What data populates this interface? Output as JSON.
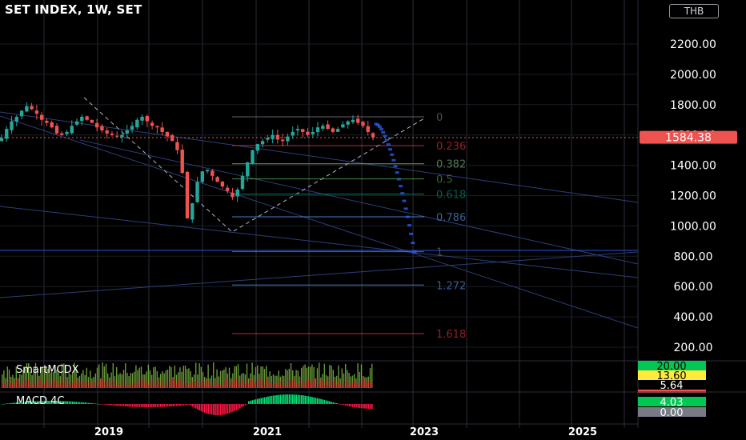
{
  "title": "SET INDEX, 1W, SET",
  "currency_button": "THB",
  "colors": {
    "background": "#000000",
    "up": "#26a69a",
    "down": "#ef5350",
    "fib_level": "#2962ff",
    "trend_line": "#2c3e7a",
    "last_price_badge": "#ef5350"
  },
  "chart_data": [
    {
      "type": "line",
      "title": "SET INDEX, 1W, SET",
      "series": [
        {
          "values": [
            1580,
            1640,
            1690,
            1720,
            1760,
            1790,
            1770,
            1740,
            1700,
            1680,
            1650,
            1610,
            1600,
            1620,
            1660,
            1690,
            1720,
            1700,
            1680,
            1650,
            1630,
            1610,
            1600,
            1590,
            1600,
            1630,
            1660,
            1700,
            1720,
            1690,
            1660,
            1650,
            1620,
            1590,
            1560,
            1500,
            1350,
            1050,
            1150,
            1290,
            1360,
            1370,
            1330,
            1290,
            1260,
            1230,
            1190,
            1240,
            1330,
            1420,
            1500,
            1540,
            1560,
            1580,
            1600,
            1570,
            1560,
            1590,
            1620,
            1640,
            1620,
            1600,
            1620,
            1650,
            1660,
            1640,
            1620,
            1640,
            1670,
            1690,
            1700,
            1680,
            1660,
            1620,
            1584
          ]
        }
      ],
      "x": [
        "2018-02",
        "2018-03",
        "2018-04",
        "2018-05",
        "2018-06",
        "2018-07",
        "2018-08",
        "2018-09",
        "2018-10",
        "2018-11",
        "2018-12",
        "2019-01",
        "2019-02",
        "2019-03",
        "2019-04",
        "2019-05",
        "2019-06",
        "2019-07",
        "2019-08",
        "2019-09",
        "2019-10",
        "2019-11",
        "2019-12",
        "2020-01",
        "2020-02",
        "2020-03a",
        "2020-03b",
        "2020-04",
        "2020-05",
        "2020-06",
        "2020-07",
        "2020-08",
        "2020-09",
        "2020-10",
        "2020-11",
        "2020-12",
        "2021-01",
        "2021-02",
        "2021-03",
        "2021-04",
        "2021-05",
        "2021-06",
        "2021-07",
        "2021-08",
        "2021-09",
        "2021-10",
        "2021-11",
        "2021-12",
        "2022-01",
        "2022-02",
        "2022-03",
        "2022-04",
        "2022-05",
        "2022-06",
        "2022-07",
        "2022-08",
        "2022-09",
        "2022-10",
        "2022-11",
        "2022-12",
        "2023-01",
        "2023-02",
        "2023-03",
        "2023-04",
        "2023-05",
        "2023-06",
        "2023-07",
        "2023-08",
        "2023-09",
        "2023-10",
        "2023-11",
        "2023-12",
        "2024-01",
        "2024-02",
        "2024-03"
      ],
      "x_tick_labels": [
        "2019",
        "2021",
        "2023",
        "2025"
      ],
      "y_tick_labels": [
        "200.00",
        "400.00",
        "600.00",
        "800.00",
        "1000.00",
        "1200.00",
        "1400.00",
        "1600.00",
        "1800.00",
        "2000.00",
        "2200.00"
      ],
      "ylim": [
        150,
        2450
      ],
      "last_price": "1584.38",
      "fib_levels": [
        {
          "label": "0",
          "value": 1720
        },
        {
          "label": "0.236",
          "value": 1530
        },
        {
          "label": "0.382",
          "value": 1410
        },
        {
          "label": "0.5",
          "value": 1310
        },
        {
          "label": "0.618",
          "value": 1210
        },
        {
          "label": "0.786",
          "value": 1060
        },
        {
          "label": "1",
          "value": 830
        },
        {
          "label": "1.272",
          "value": 610
        },
        {
          "label": "1.618",
          "value": 290
        }
      ]
    },
    {
      "type": "bar",
      "title": "SmartMCDX",
      "value_labels": [
        "20.00",
        "13.60",
        "5.64"
      ]
    },
    {
      "type": "bar",
      "title": "MACD 4C",
      "value_labels": [
        "4.03",
        "0.00"
      ]
    }
  ]
}
